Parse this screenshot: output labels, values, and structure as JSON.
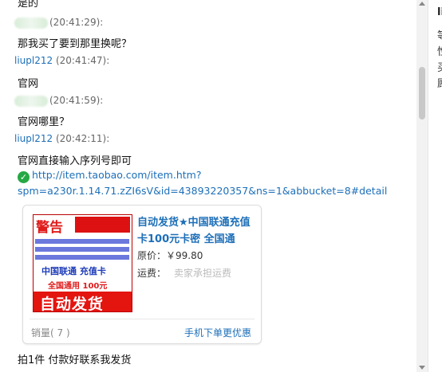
{
  "messages": [
    {
      "text": "是的"
    },
    {
      "time": "(20:41:29):",
      "text": "那我买了要到那里换呢？"
    },
    {
      "sender": "liupl212",
      "time": " (20:41:47):",
      "text": "官网"
    },
    {
      "time": "(20:41:59):",
      "text": "官网哪里？"
    },
    {
      "sender": "liupl212",
      "time": " (20:42:11):",
      "text": "官网直接输入序列号即可"
    }
  ],
  "link": {
    "line1": "http://item.taobao.com/item.htm?",
    "line2": "spm=a230r.1.14.71.zZI6sV&id=43893220357&ns=1&abbucket=8#detail",
    "icon": "verified-check-icon"
  },
  "product": {
    "title": "自动发货★中国联通充值卡100元卡密 全国通",
    "price_label": "原价：",
    "price_value": "￥99.80",
    "ship_label": "运费：",
    "ship_value": "卖家承担运费",
    "sales": "销量( 7 )",
    "mobile_link": "手机下单更优惠",
    "image": {
      "warn": "警告",
      "brand": "中国联通  充值卡",
      "scope": "全国通用 100元",
      "auto": "自动发货"
    }
  },
  "last_message": "拍1件 付款好联系我发货",
  "right_panel": {
    "title_char": "li",
    "lines": [
      "等",
      "性",
      "买",
      "顾"
    ]
  },
  "colors": {
    "link": "#1d6fb8",
    "check": "#27a844",
    "banner_red": "#e4140f"
  }
}
